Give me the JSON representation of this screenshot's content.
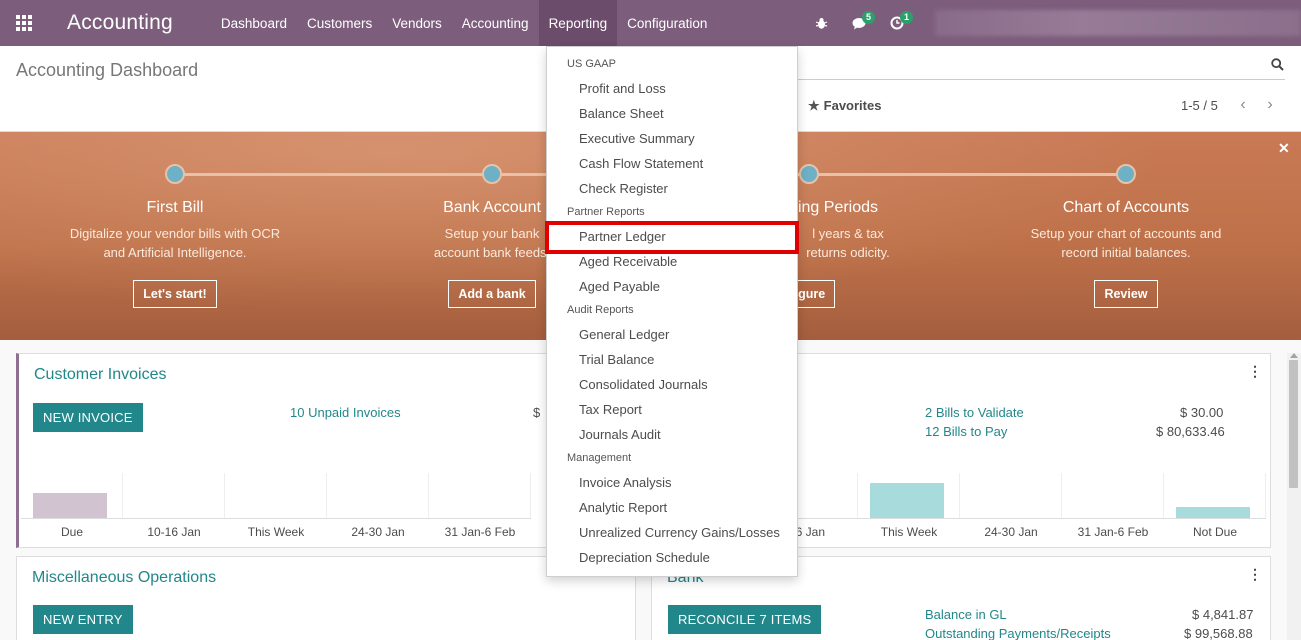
{
  "navbar": {
    "brand": "Accounting",
    "menu": [
      {
        "label": "Dashboard"
      },
      {
        "label": "Customers"
      },
      {
        "label": "Vendors"
      },
      {
        "label": "Accounting"
      },
      {
        "label": "Reporting"
      },
      {
        "label": "Configuration"
      }
    ],
    "active_menu": "Reporting",
    "messages_badge": "5",
    "activities_badge": "1",
    "accent_color": "#7c5e7c"
  },
  "control_panel": {
    "title": "Accounting Dashboard",
    "favorites_label": "Favorites",
    "pager": "1-5 / 5"
  },
  "onboarding": {
    "steps": [
      {
        "title": "First Bill",
        "desc": "Digitalize your vendor bills with OCR and Artificial Intelligence.",
        "button": "Let's start!"
      },
      {
        "title": "Bank Account",
        "desc": "Setup your bank account bank feeds.",
        "button": "Add a bank"
      },
      {
        "title": "ing Periods",
        "desc": "l years & tax returns odicity.",
        "button": "nfigure"
      },
      {
        "title": "Chart of Accounts",
        "desc": "Setup your chart of accounts and record initial balances.",
        "button": "Review"
      }
    ]
  },
  "cards": {
    "customer_invoices": {
      "title": "Customer Invoices",
      "button": "NEW INVOICE",
      "unpaid_link": "10 Unpaid Invoices",
      "amount_fragment": "$",
      "graph": {
        "labels": [
          "Due",
          "10-16 Jan",
          "This Week",
          "24-30 Jan",
          "31 Jan-6 Feb"
        ],
        "bars": [
          0.55,
          0,
          0,
          0,
          0
        ]
      }
    },
    "vendor_bills": {
      "links": [
        {
          "label": "2 Bills to Validate",
          "amount": "$ 30.00"
        },
        {
          "label": "12 Bills to Pay",
          "amount": "$ 80,633.46"
        }
      ],
      "graph": {
        "labels": [
          "16 Jan",
          "This Week",
          "24-30 Jan",
          "31 Jan-6 Feb",
          "Not Due"
        ],
        "bars": [
          0,
          0.78,
          0,
          0,
          0.25
        ]
      }
    },
    "misc_operations": {
      "title": "Miscellaneous Operations",
      "button": "NEW ENTRY"
    },
    "bank": {
      "title": "Bank",
      "button": "RECONCILE 7 ITEMS",
      "links": [
        {
          "label": "Balance in GL",
          "amount": "$ 4,841.87"
        },
        {
          "label": "Outstanding Payments/Receipts",
          "amount": "$ 99,568.88"
        }
      ]
    }
  },
  "reporting_dropdown": {
    "sections": [
      {
        "header": "US GAAP",
        "items": [
          "Profit and Loss",
          "Balance Sheet",
          "Executive Summary",
          "Cash Flow Statement",
          "Check Register"
        ]
      },
      {
        "header": "Partner Reports",
        "items": [
          "Partner Ledger",
          "Aged Receivable",
          "Aged Payable"
        ]
      },
      {
        "header": "Audit Reports",
        "items": [
          "General Ledger",
          "Trial Balance",
          "Consolidated Journals",
          "Tax Report",
          "Journals Audit"
        ]
      },
      {
        "header": "Management",
        "items": [
          "Invoice Analysis",
          "Analytic Report",
          "Unrealized Currency Gains/Losses",
          "Depreciation Schedule"
        ]
      }
    ],
    "highlighted_item": "Partner Ledger",
    "highlight_color": "#e00000"
  }
}
